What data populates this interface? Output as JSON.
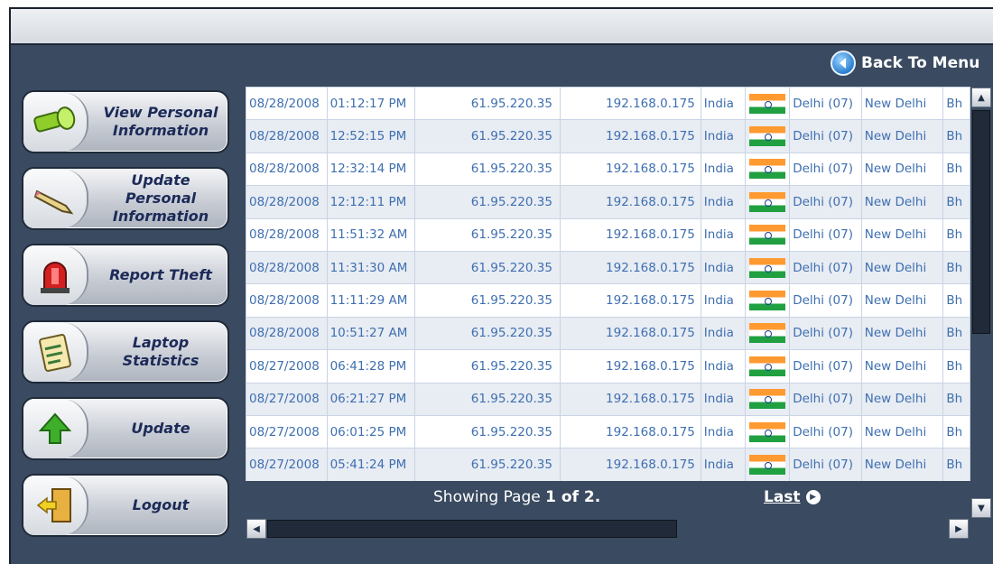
{
  "header": {
    "back_label": "Back To Menu"
  },
  "nav": [
    {
      "label": "View Personal\nInformation",
      "icon": "flashlight-icon"
    },
    {
      "label": "Update Personal\nInformation",
      "icon": "pencil-icon"
    },
    {
      "label": "Report Theft",
      "icon": "alarm-siren-icon"
    },
    {
      "label": "Laptop\nStatistics",
      "icon": "clipboard-icon"
    },
    {
      "label": "Update",
      "icon": "up-arrow-icon"
    },
    {
      "label": "Logout",
      "icon": "exit-door-icon"
    }
  ],
  "table": {
    "rows": [
      {
        "date": "08/28/2008",
        "time": "01:12:17 PM",
        "ip_public": "61.95.220.35",
        "ip_local": "192.168.0.175",
        "country": "India",
        "region": "Delhi (07)",
        "city": "New Delhi",
        "more": "Bh"
      },
      {
        "date": "08/28/2008",
        "time": "12:52:15 PM",
        "ip_public": "61.95.220.35",
        "ip_local": "192.168.0.175",
        "country": "India",
        "region": "Delhi (07)",
        "city": "New Delhi",
        "more": "Bh"
      },
      {
        "date": "08/28/2008",
        "time": "12:32:14 PM",
        "ip_public": "61.95.220.35",
        "ip_local": "192.168.0.175",
        "country": "India",
        "region": "Delhi (07)",
        "city": "New Delhi",
        "more": "Bh"
      },
      {
        "date": "08/28/2008",
        "time": "12:12:11 PM",
        "ip_public": "61.95.220.35",
        "ip_local": "192.168.0.175",
        "country": "India",
        "region": "Delhi (07)",
        "city": "New Delhi",
        "more": "Bh"
      },
      {
        "date": "08/28/2008",
        "time": "11:51:32 AM",
        "ip_public": "61.95.220.35",
        "ip_local": "192.168.0.175",
        "country": "India",
        "region": "Delhi (07)",
        "city": "New Delhi",
        "more": "Bh"
      },
      {
        "date": "08/28/2008",
        "time": "11:31:30 AM",
        "ip_public": "61.95.220.35",
        "ip_local": "192.168.0.175",
        "country": "India",
        "region": "Delhi (07)",
        "city": "New Delhi",
        "more": "Bh"
      },
      {
        "date": "08/28/2008",
        "time": "11:11:29 AM",
        "ip_public": "61.95.220.35",
        "ip_local": "192.168.0.175",
        "country": "India",
        "region": "Delhi (07)",
        "city": "New Delhi",
        "more": "Bh"
      },
      {
        "date": "08/28/2008",
        "time": "10:51:27 AM",
        "ip_public": "61.95.220.35",
        "ip_local": "192.168.0.175",
        "country": "India",
        "region": "Delhi (07)",
        "city": "New Delhi",
        "more": "Bh"
      },
      {
        "date": "08/27/2008",
        "time": "06:41:28 PM",
        "ip_public": "61.95.220.35",
        "ip_local": "192.168.0.175",
        "country": "India",
        "region": "Delhi (07)",
        "city": "New Delhi",
        "more": "Bh"
      },
      {
        "date": "08/27/2008",
        "time": "06:21:27 PM",
        "ip_public": "61.95.220.35",
        "ip_local": "192.168.0.175",
        "country": "India",
        "region": "Delhi (07)",
        "city": "New Delhi",
        "more": "Bh"
      },
      {
        "date": "08/27/2008",
        "time": "06:01:25 PM",
        "ip_public": "61.95.220.35",
        "ip_local": "192.168.0.175",
        "country": "India",
        "region": "Delhi (07)",
        "city": "New Delhi",
        "more": "Bh"
      },
      {
        "date": "08/27/2008",
        "time": "05:41:24 PM",
        "ip_public": "61.95.220.35",
        "ip_local": "192.168.0.175",
        "country": "India",
        "region": "Delhi (07)",
        "city": "New Delhi",
        "more": "Bh"
      }
    ]
  },
  "pagination": {
    "prefix": "Showing Page ",
    "current": "1",
    "of_text": " of ",
    "total": "2",
    "suffix": ".",
    "last_label": "Last"
  },
  "colors": {
    "panel": "#3a4a60",
    "link_text": "#3e6fb0",
    "nav_text": "#1c2a58"
  }
}
